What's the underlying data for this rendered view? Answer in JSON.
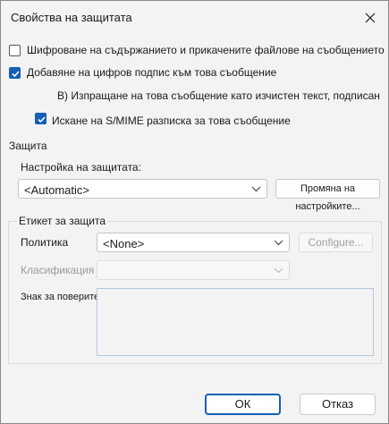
{
  "window": {
    "title": "Свойства на защитата",
    "close_icon": "close-icon"
  },
  "options": {
    "encrypt": {
      "label": "Шифроване на съдържанието и прикачените файлове на съобщението",
      "checked": false
    },
    "sign": {
      "label": "Добавяне на цифров подпис към това съобщение",
      "checked": true
    },
    "clear_text": {
      "label": "В) Изпращане на това съобщение като изчистен текст, подписан"
    },
    "receipt": {
      "label": "Искане на S/MIME разписка за това съобщение",
      "checked": true
    }
  },
  "security": {
    "heading": "Защита",
    "setting_label": "Настройка на защитата:",
    "setting_value": "<Automatic>",
    "change_button": "Промяна на настройките..."
  },
  "label_group": {
    "heading": "Етикет за защита",
    "policy_label": "Политика",
    "policy_value": "<None>",
    "configure_button": "Configure...",
    "classification_label": "Класификация",
    "classification_value": "",
    "privacy_mark_label": "Знак за поверителност:"
  },
  "footer": {
    "ok": "ОК",
    "cancel": "Отказ"
  }
}
